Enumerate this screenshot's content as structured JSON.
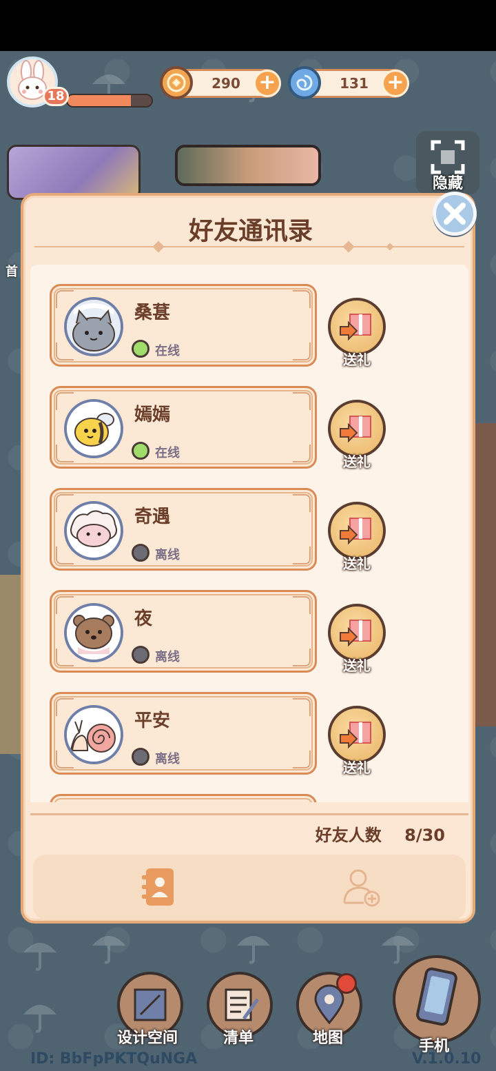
{
  "hud": {
    "level": "18",
    "xp_fraction": 0.75,
    "gold": "290",
    "gems": "131"
  },
  "side": {
    "hide_label": "隐藏",
    "left_label": "首"
  },
  "modal": {
    "title": "好友通讯录",
    "friends": [
      {
        "name": "桑葚",
        "status": "在线",
        "online": true
      },
      {
        "name": "嫣嫣",
        "status": "在线",
        "online": true
      },
      {
        "name": "奇遇",
        "status": "离线",
        "online": false
      },
      {
        "name": "夜",
        "status": "离线",
        "online": false
      },
      {
        "name": "平安",
        "status": "离线",
        "online": false
      }
    ],
    "gift_label": "送礼",
    "friend_count_label": "好友人数",
    "friend_count": "8/30"
  },
  "nav": {
    "design_space": "设计空间",
    "list": "清单",
    "map": "地图",
    "phone": "手机"
  },
  "footer": {
    "id": "ID:  BbFpPKTQuNGA",
    "version": "V.1.0.10"
  },
  "colors": {
    "online": "#9fdc6a",
    "offline": "#6d6b73",
    "accent": "#e7775a"
  }
}
